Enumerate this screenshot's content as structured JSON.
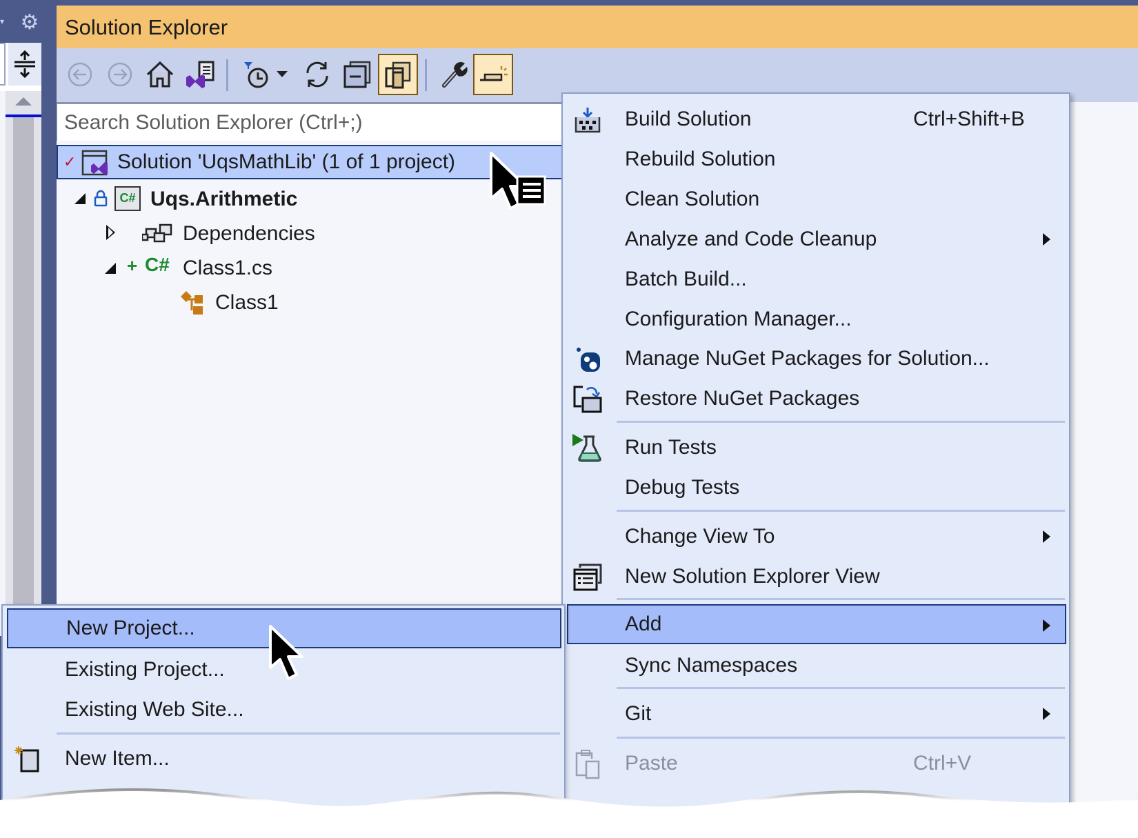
{
  "window": {
    "title": "Solution Explorer"
  },
  "left_strip": {
    "settings_icon": "gear-icon",
    "split_icon": "split-view-icon"
  },
  "toolbar": {
    "buttons": [
      {
        "name": "back-button",
        "icon": "arrow-left-circle-icon",
        "enabled": false
      },
      {
        "name": "forward-button",
        "icon": "arrow-right-circle-icon",
        "enabled": false
      },
      {
        "name": "home-button",
        "icon": "home-icon",
        "enabled": true
      },
      {
        "name": "switch-views-button",
        "icon": "vs-views-icon",
        "enabled": true
      },
      {
        "name": "pending-changes-filter-button",
        "icon": "filter-clock-icon",
        "enabled": true
      },
      {
        "name": "filter-dropdown-button",
        "icon": "caret-down-icon",
        "enabled": true
      },
      {
        "name": "sync-button",
        "icon": "refresh-icon",
        "enabled": true
      },
      {
        "name": "collapse-all-button",
        "icon": "collapse-all-icon",
        "enabled": true
      },
      {
        "name": "show-all-files-button",
        "icon": "show-all-files-icon",
        "enabled": true,
        "active": true
      },
      {
        "name": "properties-button",
        "icon": "wrench-icon",
        "enabled": true
      },
      {
        "name": "preview-selected-button",
        "icon": "preview-icon",
        "enabled": true,
        "active": true
      }
    ]
  },
  "search": {
    "placeholder": "Search Solution Explorer (Ctrl+;)",
    "value": ""
  },
  "tree": {
    "solution": {
      "label": "Solution 'UqsMathLib' (1 of 1 project)",
      "selected": true,
      "status": "checked"
    },
    "project": {
      "label": "Uqs.Arithmetic",
      "expanded": true,
      "locked": true
    },
    "dependencies": {
      "label": "Dependencies",
      "expanded": false
    },
    "file": {
      "label": "Class1.cs",
      "expanded": true,
      "status": "added"
    },
    "class": {
      "label": "Class1"
    }
  },
  "context_menu": {
    "items": [
      {
        "label": "Build Solution",
        "shortcut": "Ctrl+Shift+B",
        "icon": "build-icon"
      },
      {
        "label": "Rebuild Solution"
      },
      {
        "label": "Clean Solution"
      },
      {
        "label": "Analyze and Code Cleanup",
        "submenu": true
      },
      {
        "label": "Batch Build..."
      },
      {
        "label": "Configuration Manager..."
      },
      {
        "label": "Manage NuGet Packages for Solution...",
        "icon": "nuget-icon"
      },
      {
        "label": "Restore NuGet Packages",
        "icon": "restore-packages-icon"
      },
      {
        "label": "Run Tests",
        "icon": "run-tests-icon"
      },
      {
        "label": "Debug Tests"
      },
      {
        "label": "Change View To",
        "submenu": true
      },
      {
        "label": "New Solution Explorer View",
        "icon": "new-view-icon"
      },
      {
        "label": "Add",
        "submenu": true,
        "highlighted": true
      },
      {
        "label": "Sync Namespaces"
      },
      {
        "label": "Git",
        "submenu": true
      },
      {
        "label": "Paste",
        "shortcut": "Ctrl+V",
        "icon": "paste-icon",
        "disabled": true
      }
    ]
  },
  "add_submenu": {
    "items": [
      {
        "label": "New Project...",
        "highlighted": true
      },
      {
        "label": "Existing Project..."
      },
      {
        "label": "Existing Web Site..."
      },
      {
        "label": "New Item...",
        "icon": "new-item-icon"
      }
    ]
  },
  "colors": {
    "title_bar": "#f5c272",
    "toolbar": "#c7d1ec",
    "frame": "#4b5a8b",
    "menu_bg": "#e3eafa",
    "highlight": "#a5bcfa",
    "highlight_border": "#1d3a78",
    "selection": "#b8cdfb"
  }
}
